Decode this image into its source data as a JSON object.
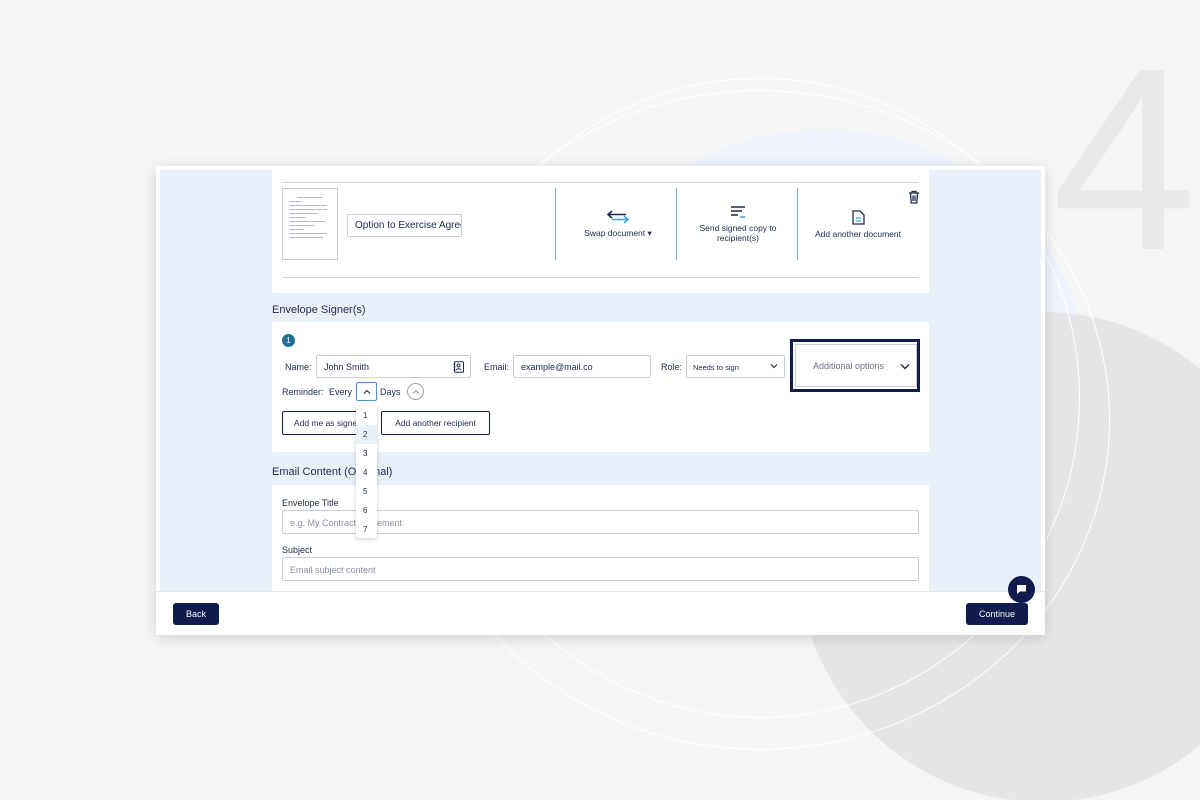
{
  "document": {
    "name": "Option to Exercise Agree",
    "actions": [
      {
        "label": "Swap document",
        "icon": "swap-arrows-icon"
      },
      {
        "label": "Send signed copy to recipient(s)",
        "icon": "lines-send-icon"
      },
      {
        "label": "Add another document",
        "icon": "add-document-icon"
      }
    ],
    "delete_icon": "trash-icon"
  },
  "signers": {
    "section_title": "Envelope Signer(s)",
    "badge": "1",
    "name_label": "Name:",
    "name_value": "John Smith",
    "email_label": "Email:",
    "email_value": "example@mail.co",
    "role_label": "Role:",
    "role_value": "Needs to sign",
    "additional_options": "Additional options",
    "reminder_label": "Reminder:",
    "every_label": "Every",
    "days_label": "Days",
    "add_me_button": "Add me as signer",
    "add_recipient_button": "Add another recipient",
    "reminder_options": [
      "1",
      "2",
      "3",
      "4",
      "5",
      "6",
      "7"
    ],
    "reminder_selected": "2"
  },
  "email_content": {
    "section_title": "Email Content (Optional)",
    "envelope_title_label": "Envelope Title",
    "envelope_title_placeholder": "e.g. My Contract Agreement",
    "subject_label": "Subject",
    "subject_placeholder": "Email subject content"
  },
  "footer": {
    "back_label": "Back",
    "continue_label": "Continue"
  },
  "decor": {
    "step_number": "4"
  },
  "colors": {
    "primary": "#0f1c4d",
    "accent_blue": "#1f6e96",
    "divider_blue": "#7bb3e0",
    "content_bg": "#eaf0fa"
  }
}
